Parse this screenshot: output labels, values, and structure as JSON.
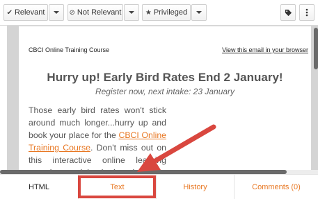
{
  "toolbar": {
    "relevant_label": "Relevant",
    "not_relevant_label": "Not Relevant",
    "privileged_label": "Privileged",
    "icons": {
      "relevant": "checkmark-icon",
      "not_relevant": "no-entry-icon",
      "privileged": "star-icon",
      "tag": "tag-icon",
      "more": "vertical-ellipsis-icon"
    }
  },
  "email": {
    "sender_line": "CBCI Online Training Course",
    "view_link": "View this email in your browser",
    "headline": "Hurry up! Early Bird Rates End 2 January!",
    "subheadline": "Register now, next intake: 23 January",
    "body_before_link": "Those early bird rates won't stick around much longer...hurry up and book your place for the ",
    "body_link": "CBCI Online Training Course",
    "body_after_link": ". Don't miss out on this interactive online learning experience joined by business continuity professionals from"
  },
  "tabs": [
    {
      "label": "HTML",
      "active": true
    },
    {
      "label": "Text",
      "active": false
    },
    {
      "label": "History",
      "active": false
    },
    {
      "label": "Comments (0)",
      "active": false
    }
  ],
  "colors": {
    "accent": "#e87722",
    "annotation": "#d9473f"
  }
}
